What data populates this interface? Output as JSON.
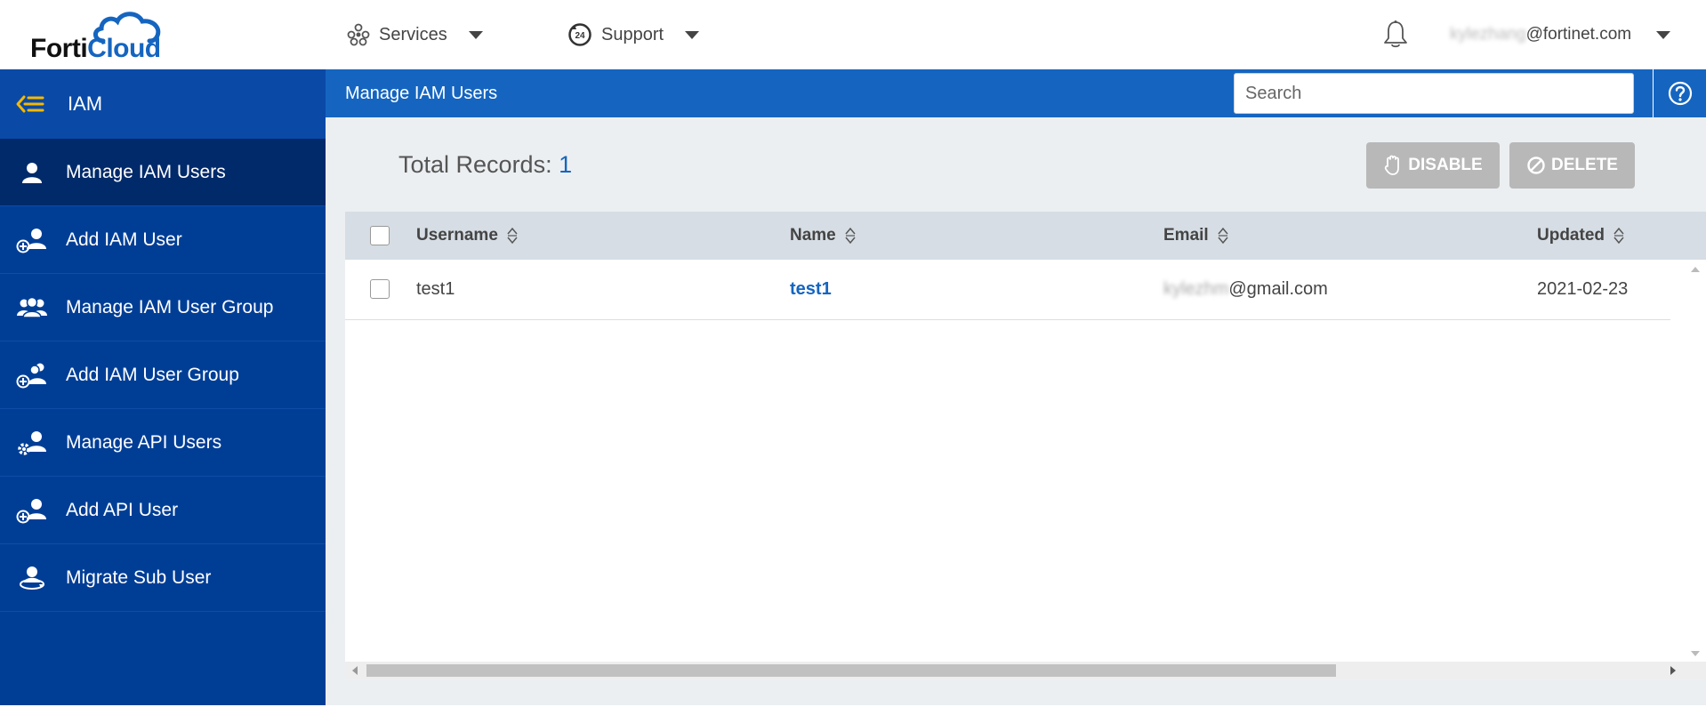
{
  "header": {
    "logo": {
      "part1": "Forti",
      "part2": "Cloud"
    },
    "services_label": "Services",
    "support_label": "Support",
    "account": {
      "user_blurred": "kylezhang",
      "domain": "@fortinet.com"
    }
  },
  "sidebar": {
    "title": "IAM",
    "items": [
      {
        "label": "Manage IAM Users",
        "icon": "user-icon",
        "active": true
      },
      {
        "label": "Add IAM User",
        "icon": "add-user-icon",
        "active": false
      },
      {
        "label": "Manage IAM User Group",
        "icon": "user-group-icon",
        "active": false
      },
      {
        "label": "Add IAM User Group",
        "icon": "add-user-group-icon",
        "active": false
      },
      {
        "label": "Manage API Users",
        "icon": "api-user-icon",
        "active": false
      },
      {
        "label": "Add API User",
        "icon": "add-api-user-icon",
        "active": false
      },
      {
        "label": "Migrate Sub User",
        "icon": "migrate-user-icon",
        "active": false
      }
    ]
  },
  "content": {
    "title": "Manage IAM Users",
    "search_placeholder": "Search",
    "total_label": "Total Records:",
    "total_count": "1",
    "disable_label": "DISABLE",
    "delete_label": "DELETE"
  },
  "table": {
    "columns": [
      "Username",
      "Name",
      "Email",
      "Updated"
    ],
    "rows": [
      {
        "username": "test1",
        "name": "test1",
        "email_blurred": "kylezhm",
        "email_domain": "@gmail.com",
        "updated": "2021-02-23"
      }
    ]
  },
  "colors": {
    "sidebar": "#003e96",
    "active_item": "#002a6a",
    "accent": "#1565c0",
    "button_disabled": "#b8b8b8"
  }
}
